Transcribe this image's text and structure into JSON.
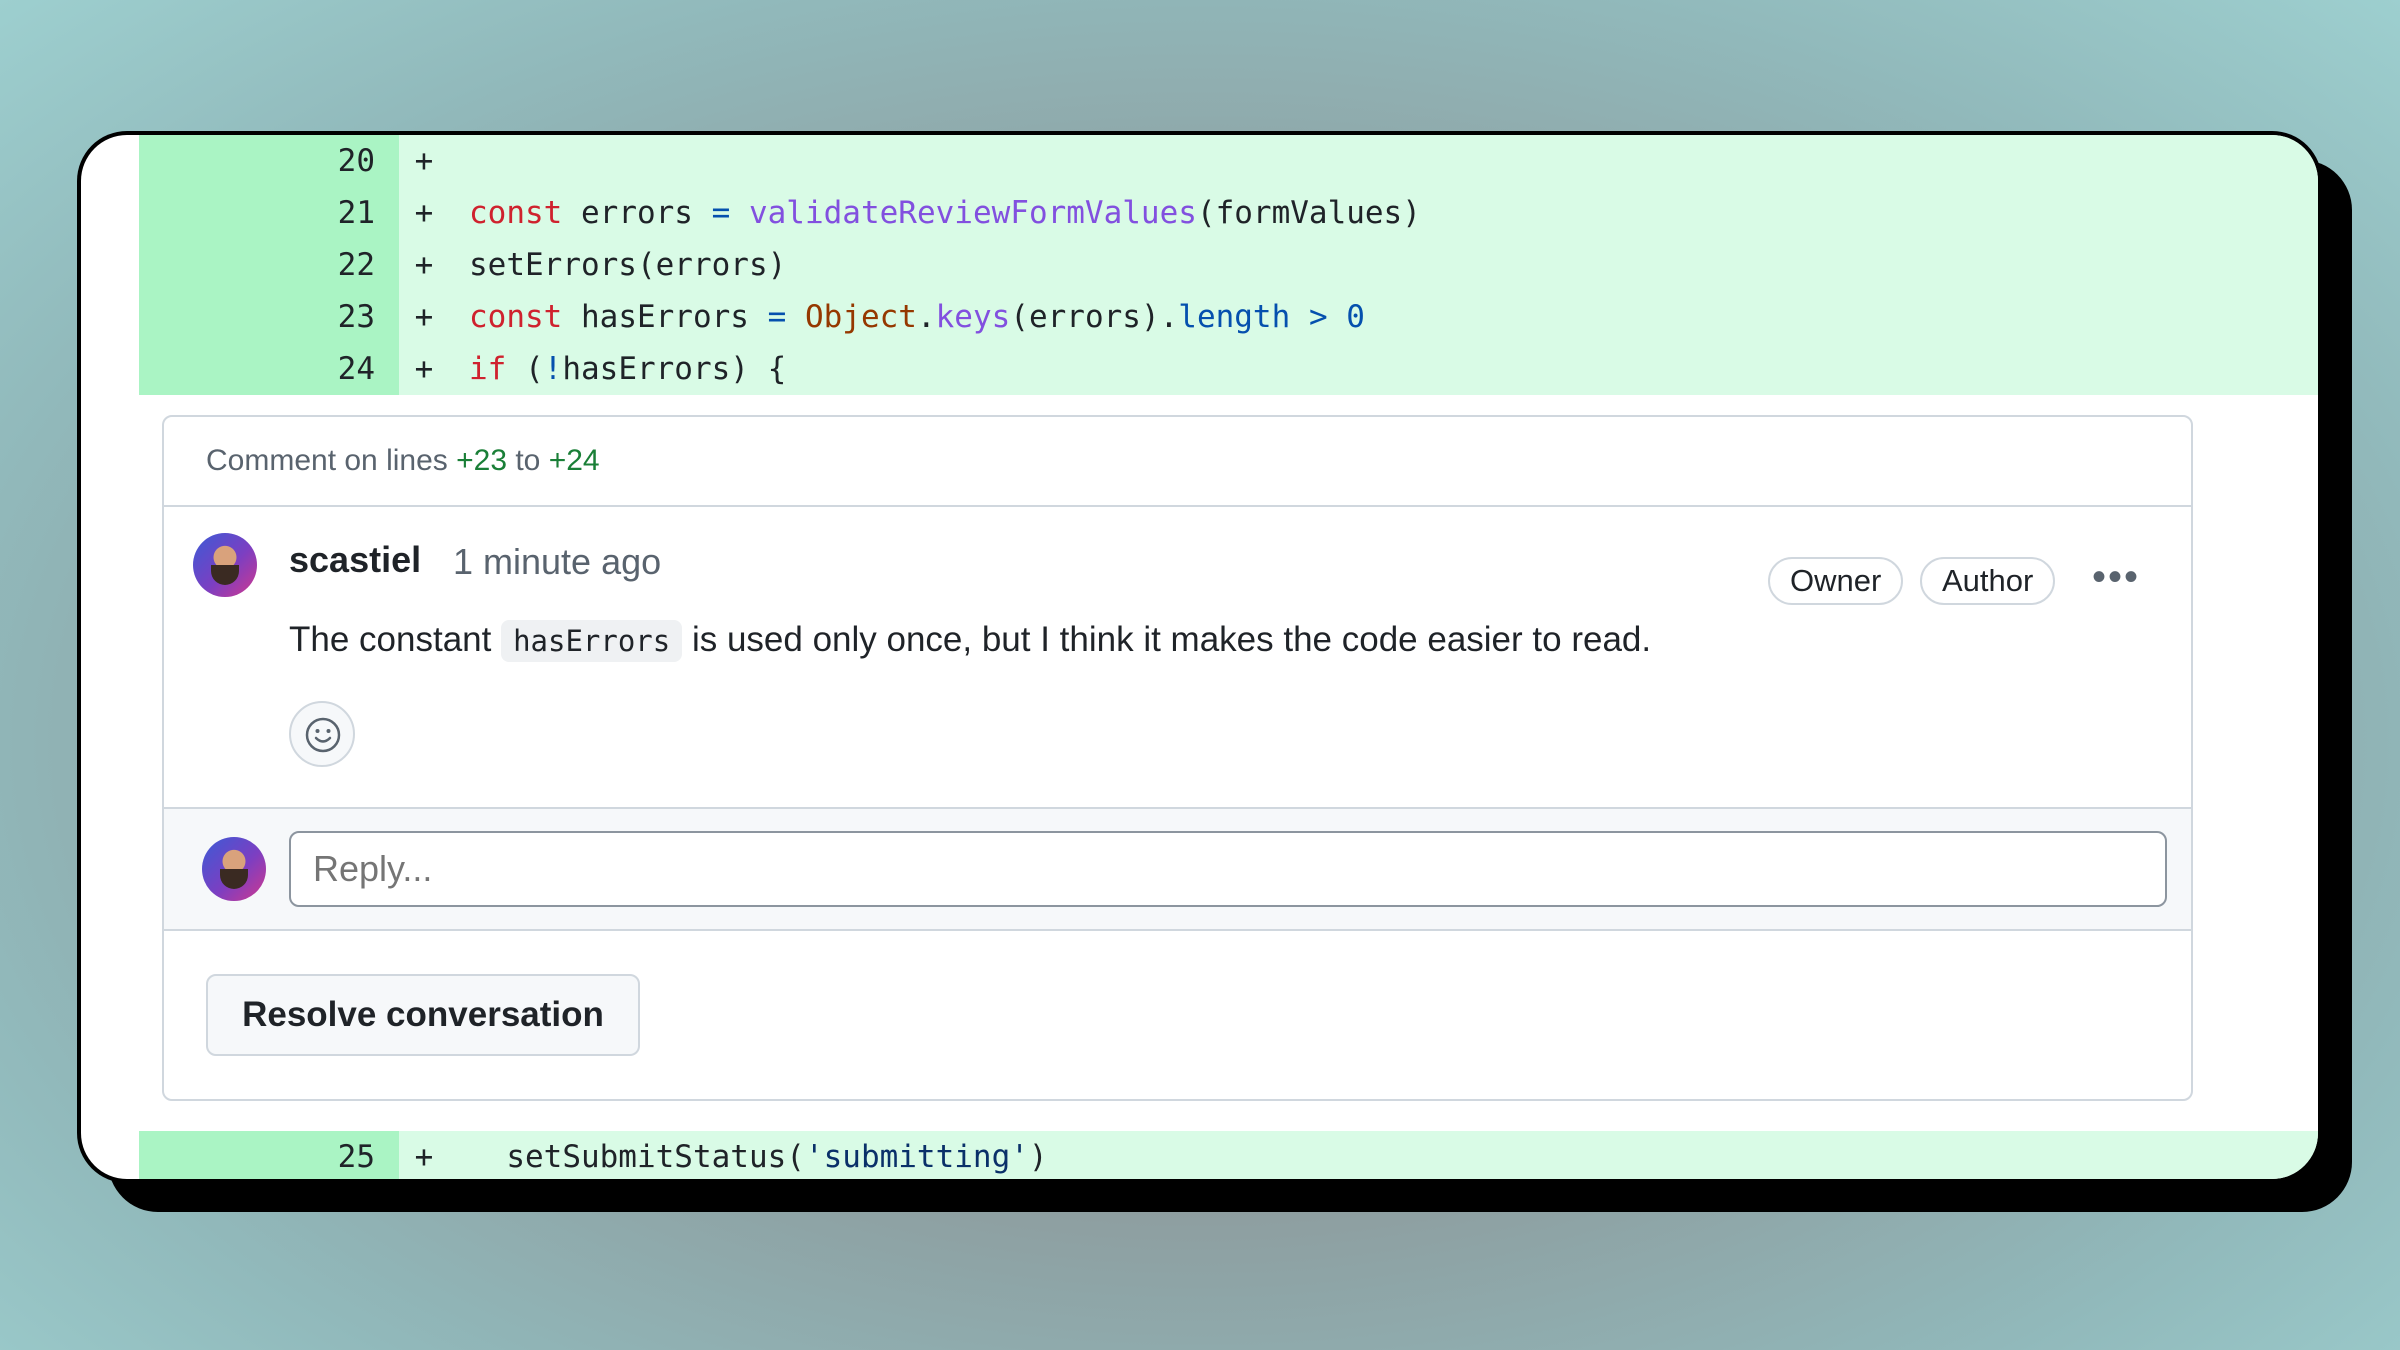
{
  "diff_top": [
    {
      "num": "20",
      "sign": "+",
      "tokens": []
    },
    {
      "num": "21",
      "sign": "+",
      "tokens": [
        {
          "t": "const",
          "c": "k"
        },
        {
          "t": " errors ",
          "c": ""
        },
        {
          "t": "=",
          "c": "o"
        },
        {
          "t": " ",
          "c": ""
        },
        {
          "t": "validateReviewFormValues",
          "c": "f"
        },
        {
          "t": "(formValues)",
          "c": ""
        }
      ]
    },
    {
      "num": "22",
      "sign": "+",
      "tokens": [
        {
          "t": "setErrors(errors)",
          "c": ""
        }
      ]
    },
    {
      "num": "23",
      "sign": "+",
      "tokens": [
        {
          "t": "const",
          "c": "k"
        },
        {
          "t": " hasErrors ",
          "c": ""
        },
        {
          "t": "=",
          "c": "o"
        },
        {
          "t": " ",
          "c": ""
        },
        {
          "t": "Object",
          "c": "c"
        },
        {
          "t": ".",
          "c": ""
        },
        {
          "t": "keys",
          "c": "f"
        },
        {
          "t": "(errors).",
          "c": ""
        },
        {
          "t": "length",
          "c": "o"
        },
        {
          "t": " ",
          "c": ""
        },
        {
          "t": ">",
          "c": "o"
        },
        {
          "t": " ",
          "c": ""
        },
        {
          "t": "0",
          "c": "o"
        }
      ]
    },
    {
      "num": "24",
      "sign": "+",
      "tokens": [
        {
          "t": "if",
          "c": "k"
        },
        {
          "t": " (",
          "c": ""
        },
        {
          "t": "!",
          "c": "o"
        },
        {
          "t": "hasErrors) {",
          "c": ""
        }
      ]
    }
  ],
  "diff_bottom": [
    {
      "num": "25",
      "sign": "+",
      "tokens": [
        {
          "t": "  setSubmitStatus(",
          "c": ""
        },
        {
          "t": "'submitting'",
          "c": "s"
        },
        {
          "t": ")",
          "c": ""
        }
      ]
    }
  ],
  "thread": {
    "header_prefix": "Comment on lines ",
    "line_start": "+23",
    "header_mid": " to ",
    "line_end": "+24"
  },
  "comment": {
    "author": "scastiel",
    "time": "1 minute ago",
    "badges": [
      "Owner",
      "Author"
    ],
    "more_label": "•••",
    "text_before": "The constant ",
    "inline_code": "hasErrors",
    "text_after": " is used only once, but I think it makes the code easier to read."
  },
  "reply": {
    "placeholder": "Reply..."
  },
  "resolve_label": "Resolve conversation"
}
